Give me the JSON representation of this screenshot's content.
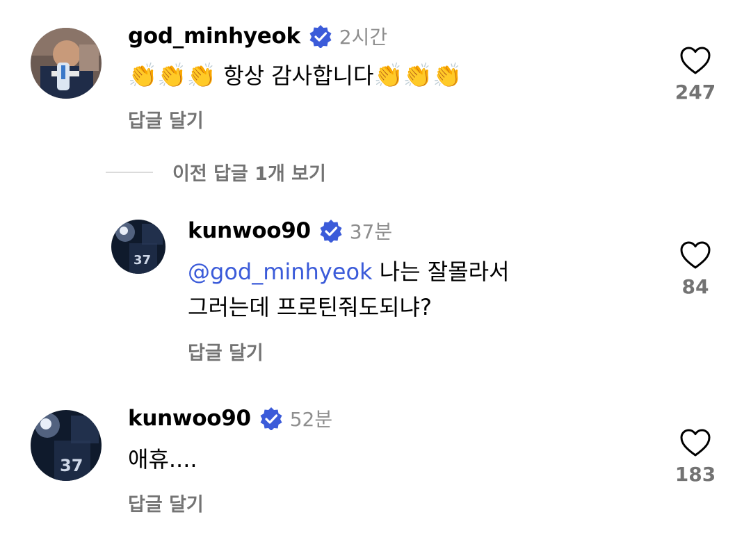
{
  "comments": [
    {
      "username": "god_minhyeok",
      "verified": true,
      "time": "2시간",
      "text_prefix": "👏👏👏",
      "text_main": " 항상 감사합니다",
      "text_suffix": "👏👏👏",
      "reply_label": "답글 달기",
      "likes": "247"
    }
  ],
  "prev_replies_label": "이전 답글 1개 보기",
  "replies": [
    {
      "username": "kunwoo90",
      "verified": true,
      "time": "37분",
      "mention": "@god_minhyeok",
      "text_line1": " 나는 잘몰라서",
      "text_line2": "그러는데 프로틴줘도되냐?",
      "reply_label": "답글 달기",
      "likes": "84"
    }
  ],
  "comment2": {
    "username": "kunwoo90",
    "verified": true,
    "time": "52분",
    "text": "애휴....",
    "reply_label": "답글 달기",
    "likes": "183"
  },
  "colors": {
    "verified_badge": "#3b5bd9",
    "mention": "#3b5bd9",
    "secondary_text": "#737373",
    "time_text": "#8e8e8e"
  },
  "icons": {
    "verified": "verified-badge-icon",
    "like": "heart-outline-icon",
    "mention": "threads-at-icon"
  }
}
